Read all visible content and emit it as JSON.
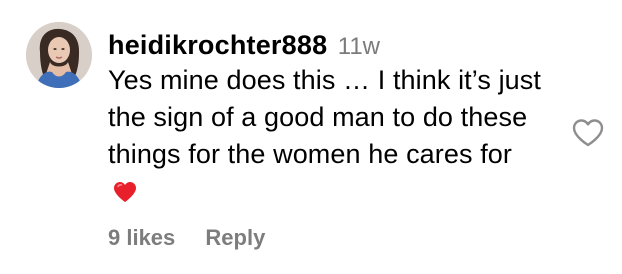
{
  "comment": {
    "username": "heidikrochter888",
    "timestamp": "11w",
    "text": "Yes mine does this … I think it’s just the sign of a good man to do these things for the women he cares for",
    "emoji": "red-heart-emoji",
    "likes_label": "9 likes",
    "reply_label": "Reply",
    "like_icon": "heart-outline-icon",
    "colors": {
      "text": "#000000",
      "muted": "#7d7d7d",
      "heart_emoji": "#e8202b",
      "like_icon_stroke": "#8e8e8e"
    }
  }
}
